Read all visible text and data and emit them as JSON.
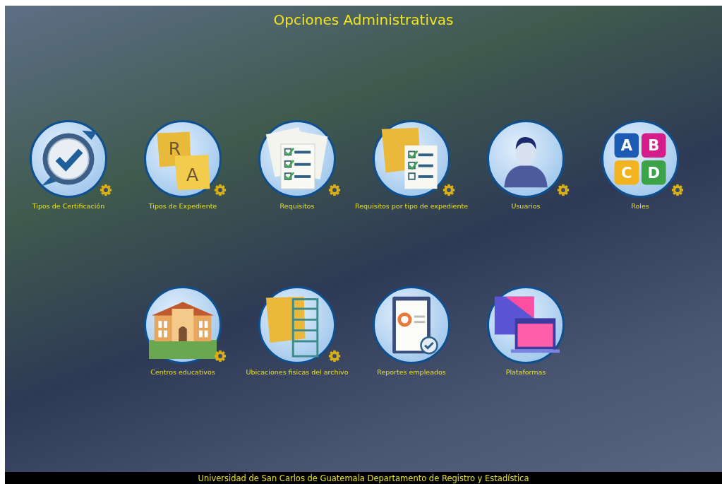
{
  "title": "Opciones Administrativas",
  "rows": [
    [
      {
        "label": "Tipos de Certificación",
        "kind": "certificate",
        "settings": true
      },
      {
        "label": "Tipos de Expediente",
        "kind": "folders",
        "letters": [
          "R",
          "A"
        ],
        "settings": true
      },
      {
        "label": "Requisitos",
        "kind": "checklist",
        "settings": true
      },
      {
        "label": "Requisitos por tipo de expediente",
        "kind": "folder-checklist",
        "settings": true
      },
      {
        "label": "Usuarios",
        "kind": "user",
        "settings": true
      },
      {
        "label": "Roles",
        "kind": "puzzle",
        "letters": [
          "A",
          "B",
          "C",
          "D"
        ],
        "settings": true
      }
    ],
    [
      {
        "label": "Centros educativos",
        "kind": "school",
        "settings": true
      },
      {
        "label": "Ubicaciones fisicas del archivo",
        "kind": "shelf",
        "settings": true
      },
      {
        "label": "Reportes empleados",
        "kind": "report",
        "settings": false
      },
      {
        "label": "Plataformas",
        "kind": "screens",
        "settings": false
      }
    ]
  ],
  "footer": "Universidad de San Carlos de Guatemala Departamento de Registro y Estadística"
}
